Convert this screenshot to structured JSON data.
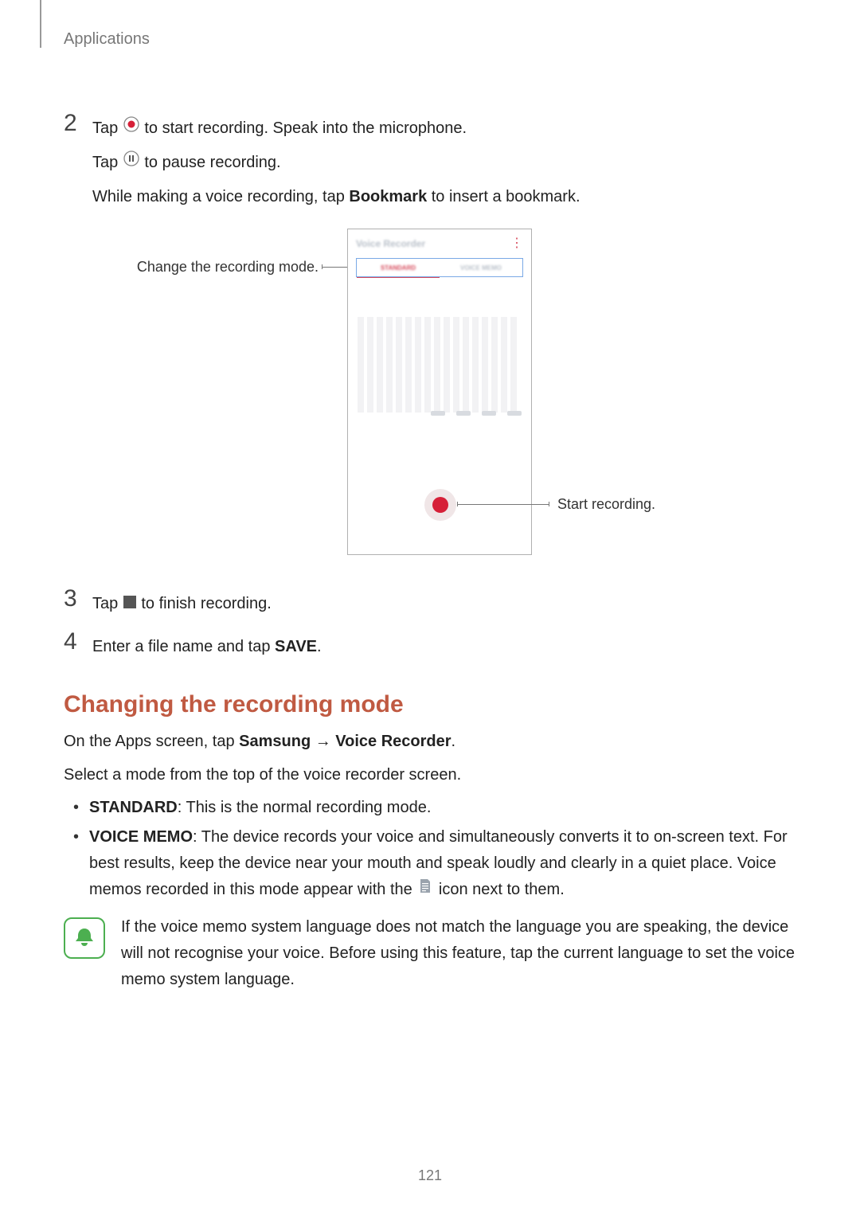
{
  "header": {
    "section": "Applications"
  },
  "steps": {
    "s2": {
      "num": "2",
      "line1_a": "Tap ",
      "line1_b": " to start recording. Speak into the microphone.",
      "line2_a": "Tap ",
      "line2_b": " to pause recording.",
      "line3_a": "While making a voice recording, tap ",
      "line3_bold": "Bookmark",
      "line3_b": " to insert a bookmark."
    },
    "s3": {
      "num": "3",
      "line_a": "Tap ",
      "line_b": " to finish recording."
    },
    "s4": {
      "num": "4",
      "line_a": "Enter a file name and tap ",
      "line_bold": "SAVE",
      "line_b": "."
    }
  },
  "figure": {
    "callout_left": "Change the recording mode.",
    "callout_right": "Start recording.",
    "phone_title": "Voice Recorder",
    "tab_active": "STANDARD",
    "tab_inactive": "VOICE MEMO"
  },
  "section2": {
    "heading": "Changing the recording mode",
    "p1_a": "On the Apps screen, tap ",
    "p1_b1": "Samsung",
    "p1_arrow": " → ",
    "p1_b2": "Voice Recorder",
    "p1_c": ".",
    "p2": "Select a mode from the top of the voice recorder screen.",
    "modes": {
      "standard_label": "STANDARD",
      "standard_desc": ": This is the normal recording mode.",
      "memo_label": "VOICE MEMO",
      "memo_desc_a": ": The device records your voice and simultaneously converts it to on-screen text. For best results, keep the device near your mouth and speak loudly and clearly in a quiet place. Voice memos recorded in this mode appear with the ",
      "memo_desc_b": " icon next to them."
    },
    "note": "If the voice memo system language does not match the language you are speaking, the device will not recognise your voice. Before using this feature, tap the current language to set the voice memo system language."
  },
  "page_number": "121"
}
